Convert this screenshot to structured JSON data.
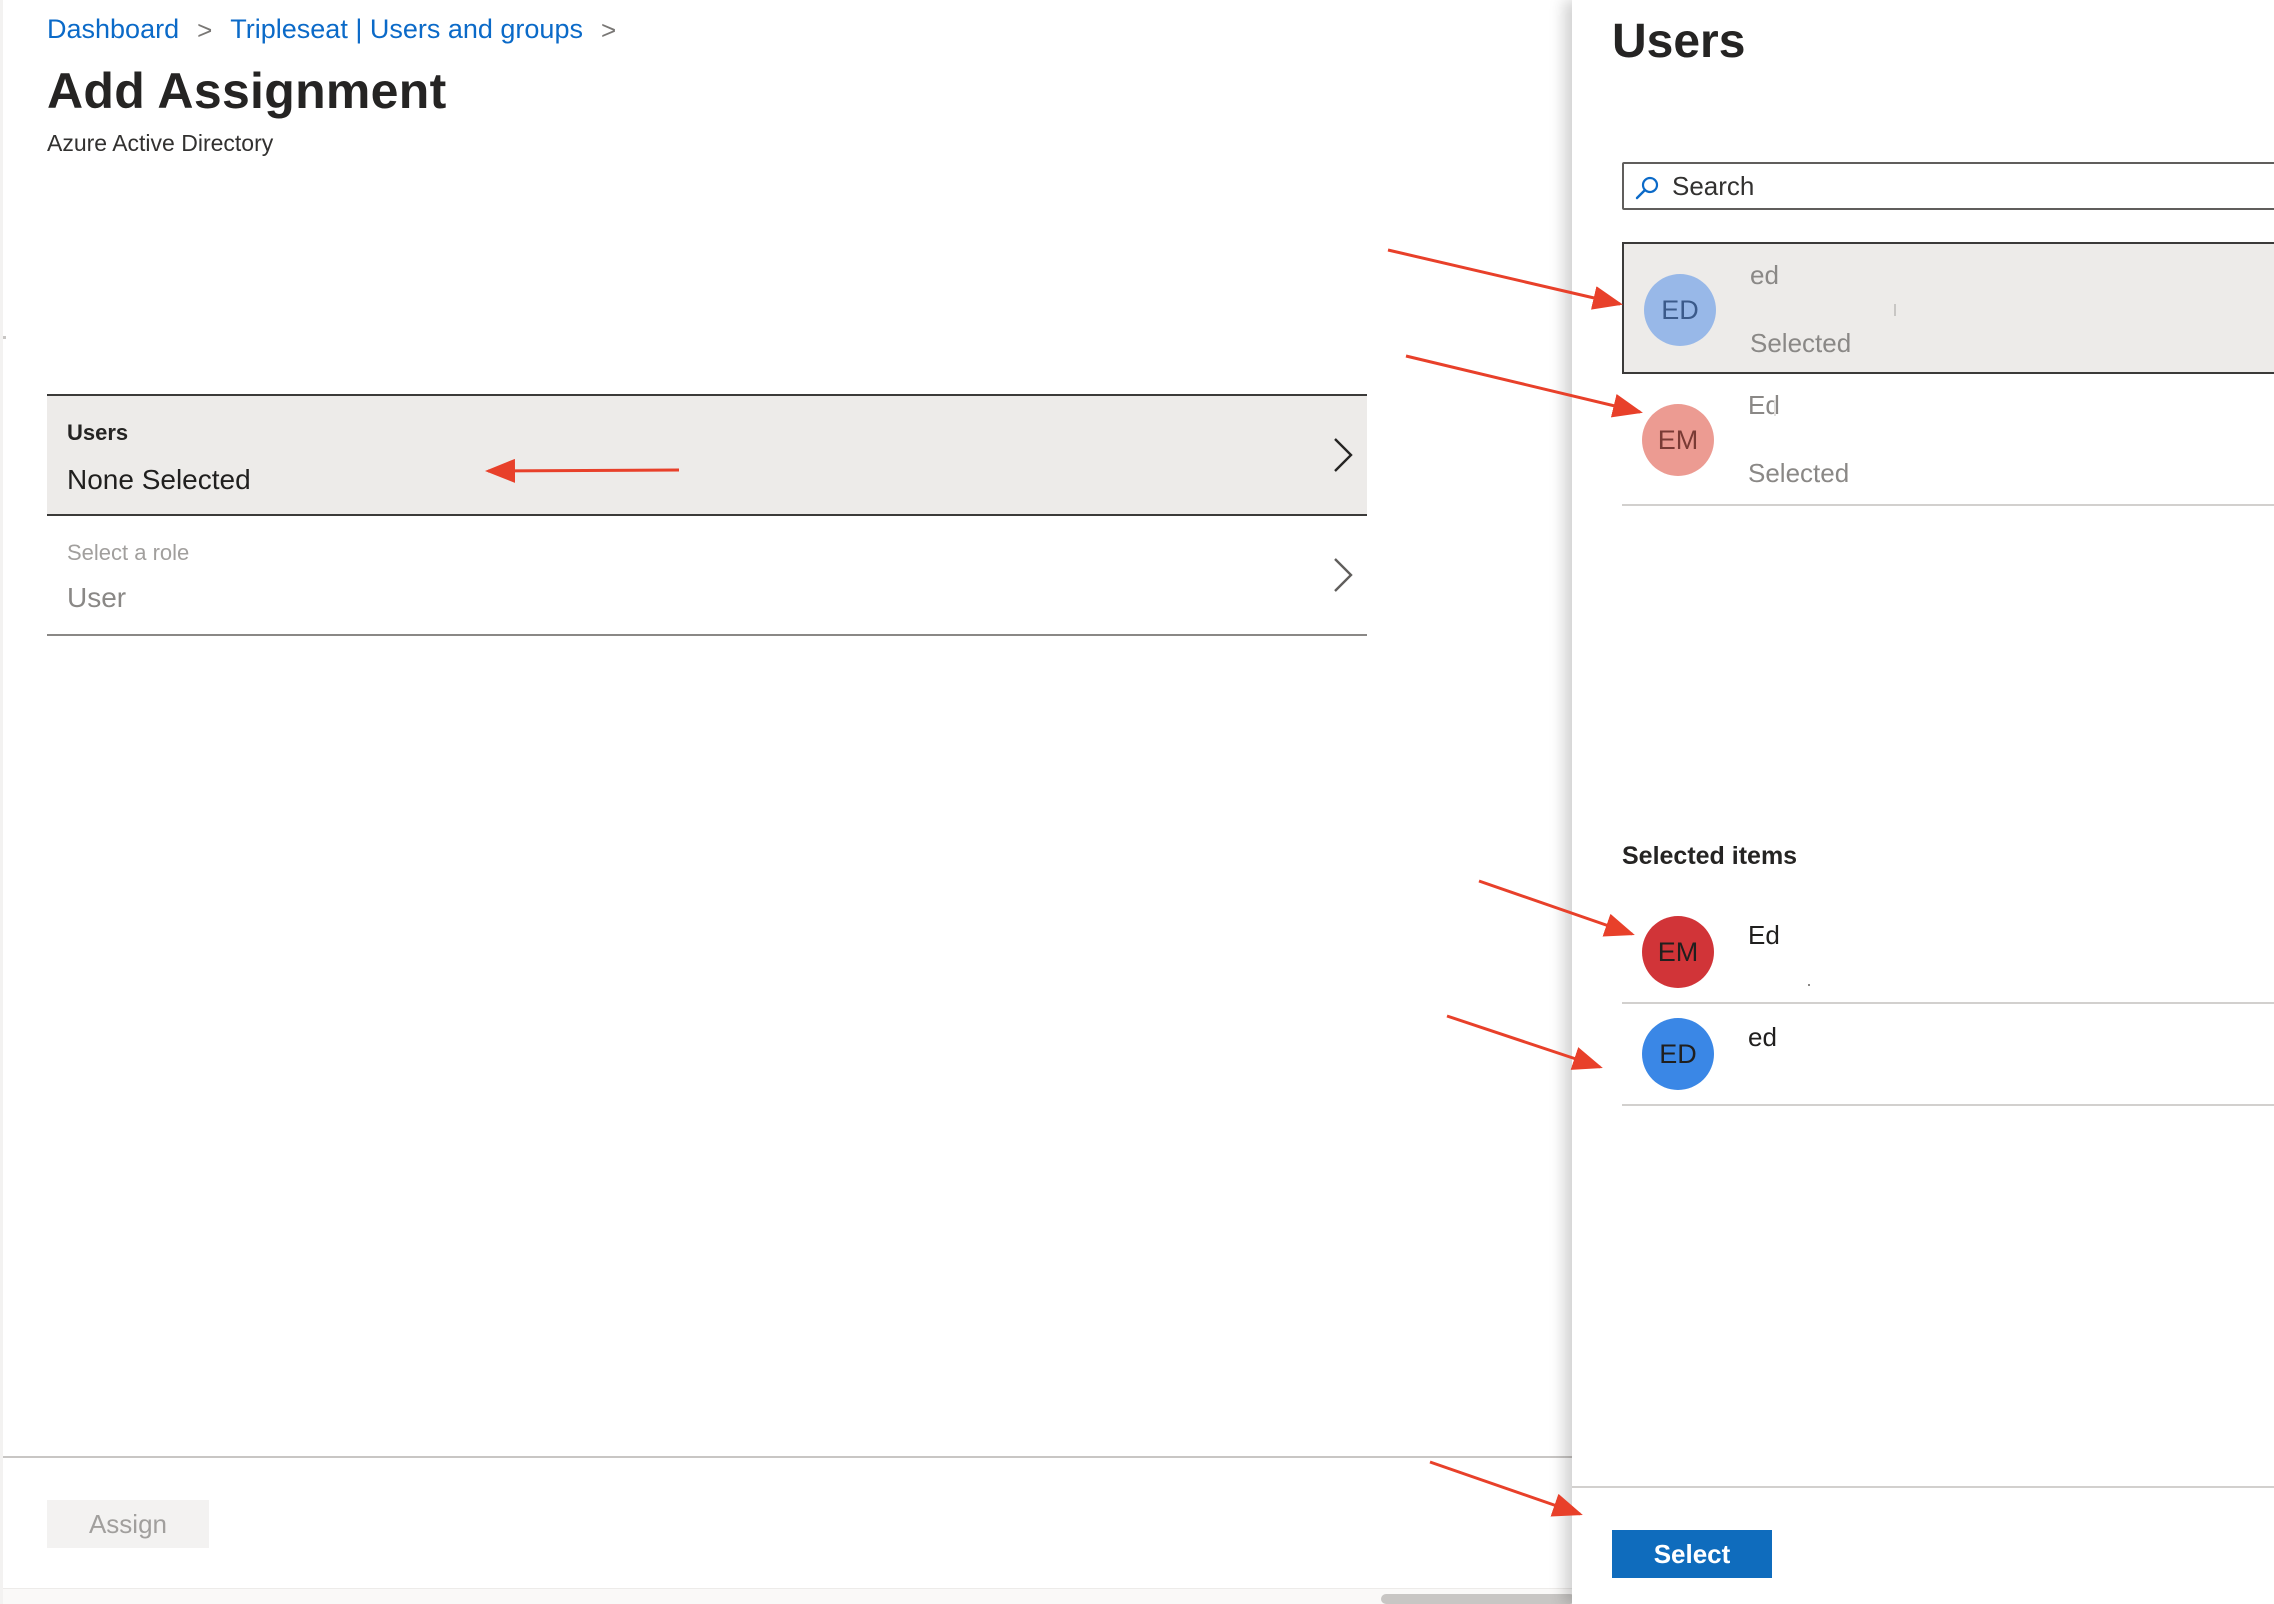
{
  "breadcrumb": {
    "items": [
      {
        "label": "Dashboard"
      },
      {
        "label": "Tripleseat | Users and groups"
      }
    ],
    "separator": ">"
  },
  "header": {
    "title": "Add Assignment",
    "subtitle": "Azure Active Directory"
  },
  "assignment": {
    "users_label": "Users",
    "users_value": "None Selected",
    "role_label": "Select a role",
    "role_value": "User"
  },
  "footer": {
    "assign_label": "Assign"
  },
  "users_panel": {
    "title": "Users",
    "search": {
      "placeholder": "Search",
      "value": ""
    },
    "results": [
      {
        "initials": "ED",
        "name": "ed",
        "status": "Selected",
        "avatar_color": "#98b8e8",
        "initials_color": "#3b5a8a"
      },
      {
        "initials": "EM",
        "name": "Ed",
        "status": "Selected",
        "avatar_color": "#ec9b92",
        "initials_color": "#7a3b35"
      }
    ],
    "selected_heading": "Selected items",
    "selected_items": [
      {
        "initials": "EM",
        "name": "Ed",
        "avatar_color": "#d13438",
        "initials_color": "#201f1e"
      },
      {
        "initials": "ED",
        "name": "ed",
        "avatar_color": "#3a87e6",
        "initials_color": "#201f1e"
      }
    ],
    "select_label": "Select"
  },
  "colors": {
    "link": "#0b6ac8",
    "primary_button": "#0f6cbd",
    "annotation_arrow": "#e8402a",
    "row_highlight": "#edebe9"
  }
}
